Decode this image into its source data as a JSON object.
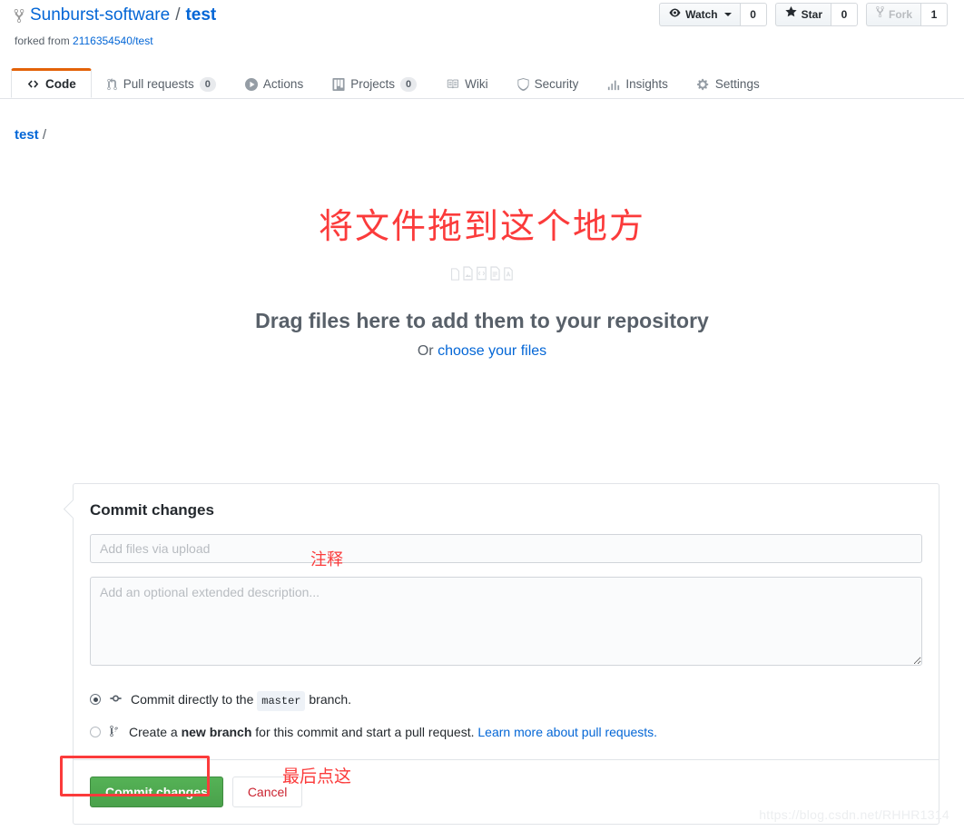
{
  "repo": {
    "owner": "Sunburst-software",
    "separator": "/",
    "name": "test",
    "forked_from_label": "forked from",
    "forked_from_repo": "2116354540/test"
  },
  "social": {
    "watch_label": "Watch",
    "watch_count": "0",
    "star_label": "Star",
    "star_count": "0",
    "fork_label": "Fork",
    "fork_count": "1"
  },
  "nav": {
    "tabs": [
      {
        "label": "Code",
        "count": "",
        "icon": "code-icon",
        "active": true
      },
      {
        "label": "Pull requests",
        "count": "0",
        "icon": "pull-request-icon",
        "active": false
      },
      {
        "label": "Actions",
        "count": "",
        "icon": "play-icon",
        "active": false
      },
      {
        "label": "Projects",
        "count": "0",
        "icon": "project-board-icon",
        "active": false
      },
      {
        "label": "Wiki",
        "count": "",
        "icon": "book-icon",
        "active": false
      },
      {
        "label": "Security",
        "count": "",
        "icon": "shield-icon",
        "active": false
      },
      {
        "label": "Insights",
        "count": "",
        "icon": "graph-icon",
        "active": false
      },
      {
        "label": "Settings",
        "count": "",
        "icon": "gear-icon",
        "active": false
      }
    ]
  },
  "breadcrumb": {
    "root": "test",
    "separator": "/"
  },
  "dropzone": {
    "annotation_red": "将文件拖到这个地方",
    "title": "Drag files here to add them to your repository",
    "or_text": "Or ",
    "choose_link": "choose your files",
    "file_icons": [
      "file-icon",
      "file-media-icon",
      "file-code-icon",
      "file-text-icon",
      "file-pdf-icon"
    ]
  },
  "commit": {
    "heading": "Commit changes",
    "summary_placeholder": "Add files via upload",
    "summary_value": "",
    "description_placeholder": "Add an optional extended description...",
    "description_value": "",
    "annotation_summary": "注释",
    "option_direct_prefix": "Commit directly to the ",
    "option_direct_branch": "master",
    "option_direct_suffix": " branch.",
    "option_branch_prefix": "Create a ",
    "option_branch_bold": "new branch",
    "option_branch_suffix": " for this commit and start a pull request. ",
    "option_branch_link": "Learn more about pull requests.",
    "commit_button": "Commit changes",
    "cancel_button": "Cancel",
    "annotation_last": "最后点这"
  },
  "watermark": "https://blog.csdn.net/RHHR1314",
  "colors": {
    "link": "#0366d6",
    "annotation_red": "#fb3b3b",
    "active_tab_accent": "#e36209",
    "commit_green": "#4aa14b"
  }
}
